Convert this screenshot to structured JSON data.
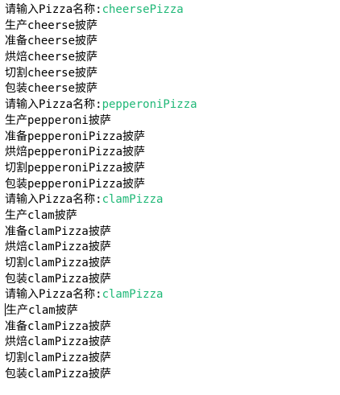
{
  "colors": {
    "background": "#ffffff",
    "text": "#000000",
    "user_input": "#1fb877"
  },
  "console": {
    "lines": [
      {
        "text": "请输入Pizza名称:",
        "input": "cheersePizza"
      },
      {
        "text": "生产cheerse披萨"
      },
      {
        "text": "准备cheerse披萨"
      },
      {
        "text": "烘焙cheerse披萨"
      },
      {
        "text": "切割cheerse披萨"
      },
      {
        "text": "包装cheerse披萨"
      },
      {
        "text": "请输入Pizza名称:",
        "input": "pepperoniPizza"
      },
      {
        "text": "生产pepperoni披萨"
      },
      {
        "text": "准备pepperoniPizza披萨"
      },
      {
        "text": "烘焙pepperoniPizza披萨"
      },
      {
        "text": "切割pepperoniPizza披萨"
      },
      {
        "text": "包装pepperoniPizza披萨"
      },
      {
        "text": "请输入Pizza名称:",
        "input": "clamPizza"
      },
      {
        "text": "生产clam披萨"
      },
      {
        "text": "准备clamPizza披萨"
      },
      {
        "text": "烘焙clamPizza披萨"
      },
      {
        "text": "切割clamPizza披萨"
      },
      {
        "text": "包装clamPizza披萨"
      },
      {
        "text": "请输入Pizza名称:",
        "input": "clamPizza"
      },
      {
        "text": "生产clam披萨"
      },
      {
        "text": "准备clamPizza披萨"
      },
      {
        "text": "烘焙clamPizza披萨"
      },
      {
        "text": "切割clamPizza披萨"
      },
      {
        "text": "包装clamPizza披萨"
      }
    ]
  }
}
